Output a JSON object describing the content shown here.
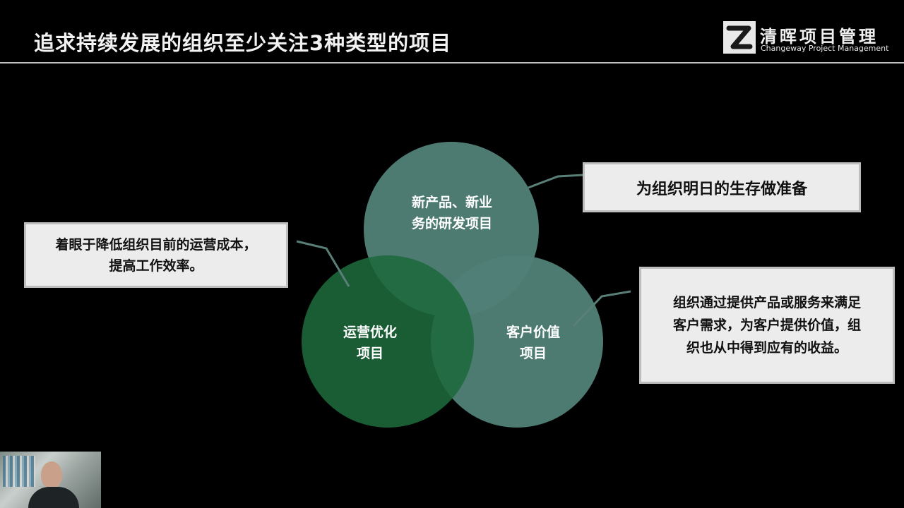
{
  "slide": {
    "title": "追求持续发展的组织至少关注3种类型的项目"
  },
  "logo": {
    "name": "清晖项目管理",
    "subtitle": "Changeway Project Management"
  },
  "diagram": {
    "circles": {
      "top": {
        "line1": "新产品、新业",
        "line2": "务的研发项目",
        "color": "#4f7f76"
      },
      "left": {
        "line1": "运营优化",
        "line2": "项目",
        "color": "#1e6a3c"
      },
      "right": {
        "line1": "客户价值",
        "line2": "项目",
        "color": "#4f7f76"
      }
    },
    "callouts": {
      "top": {
        "text": "为组织明日的生存做准备"
      },
      "left": {
        "line1": "着眼于降低组织目前的运营成本，",
        "line2": "提高工作效率。"
      },
      "right": {
        "line1": "组织通过提供产品或服务来满足",
        "line2": "客户需求，为客户提供价值，组",
        "line3": "织也从中得到应有的收益。"
      }
    },
    "connector_color": "#5a7f78"
  },
  "video_overlay": {
    "icon": "presenter-webcam"
  }
}
